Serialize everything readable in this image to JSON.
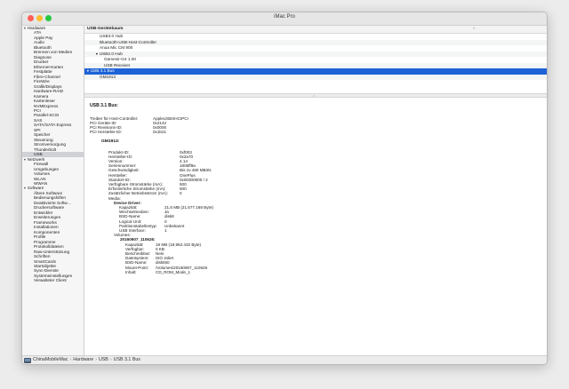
{
  "window": {
    "title": "iMac Pro"
  },
  "sidebar": {
    "sections": [
      {
        "label": "Hardware",
        "items": [
          "ATA",
          "Apple Pay",
          "Audio",
          "Bluetooth",
          "Brennen von Medien",
          "Diagnose",
          "Drucker",
          "Ethernet-Karten",
          "Festplatte",
          "Fibre-Channel",
          "FireWire",
          "Grafik/Displays",
          "Hardware-RAID",
          "Kamera",
          "Kartenleser",
          "NVMExpress",
          "PCI",
          "Parallel-SCSI",
          "SAS",
          "SATA/SATA Express",
          "SPI",
          "Speicher",
          "Steuerung",
          "Stromversorgung",
          "Thunderbolt",
          "USB"
        ]
      },
      {
        "label": "Netzwerk",
        "items": [
          "Firewall",
          "Umgebungen",
          "Volumes",
          "WLAN",
          "WWAN"
        ]
      },
      {
        "label": "Software",
        "items": [
          "Ältere Software",
          "Bedienungshilfen",
          "Deaktivierte Softw…",
          "Druckersoftware",
          "Entwickler",
          "Erweiterungen",
          "Frameworks",
          "Installationen",
          "Komponenten",
          "Profile",
          "Programme",
          "Protokolldateien",
          "Raw-Unterstützung",
          "Schriften",
          "SmartCards",
          "Startobjekte",
          "Sync-Dienste",
          "Systemeinstellungen",
          "Verwalteter Client"
        ]
      }
    ],
    "selected": "USB"
  },
  "tree": {
    "header": "USB-Gerätebaum",
    "sort_arrow": "^",
    "rows": [
      {
        "label": "USB3.0 Hub",
        "indent": 3
      },
      {
        "label": "Bluetooth-USB-Host-Controller",
        "indent": 3
      },
      {
        "label": "Anua Mic CM 900",
        "indent": 3
      },
      {
        "label": "USB2.0 Hub",
        "indent": 2,
        "expander": "▼"
      },
      {
        "label": "Gamesir-G4 1.00",
        "indent": 4
      },
      {
        "label": "USB Receiver",
        "indent": 4
      },
      {
        "label": "USB 3.1 Bus",
        "indent": 0,
        "expander": "▼",
        "selected": true
      },
      {
        "label": "GM1913",
        "indent": 3
      }
    ],
    "splitter_grip": "="
  },
  "detail": {
    "title": "USB 3.1 Bus:",
    "bus_info": [
      {
        "k": "Treiber für Host-Controller:",
        "v": "AppleUSBXHCIPCI"
      },
      {
        "k": "PCI Geräte-ID:",
        "v": "0x2142"
      },
      {
        "k": "PCI Revisions-ID:",
        "v": "0x0000"
      },
      {
        "k": "PCI Hersteller-ID:",
        "v": "0x1b21"
      }
    ],
    "device_title": "GM1913:",
    "device_info": [
      {
        "k": "Produkt-ID:",
        "v": "0xf003"
      },
      {
        "k": "Hersteller-ID:",
        "v": "0x2a70"
      },
      {
        "k": "Version:",
        "v": "4.14"
      },
      {
        "k": "Seriennummer:",
        "v": "1806ff9a"
      },
      {
        "k": "Geschwindigkeit:",
        "v": "Bis zu 480 MBit/s"
      },
      {
        "k": "Hersteller:",
        "v": "OnePlus"
      },
      {
        "k": "Standort-ID:",
        "v": "0x00300000 / 2"
      },
      {
        "k": "Verfügbare Stromstärke (mA):",
        "v": "500"
      },
      {
        "k": "Erforderliche Stromstärke (mA):",
        "v": "500"
      },
      {
        "k": "Zusätzlicher Betriebsstrom (mA):",
        "v": "0"
      }
    ],
    "media_label": "Media:",
    "driver_title": "Device Driver:",
    "driver_info": [
      {
        "k": "Kapazität:",
        "v": "21,6 MB (21.577.168 Byte)"
      },
      {
        "k": "Wechselmedien:",
        "v": "Ja"
      },
      {
        "k": "BSD-Name:",
        "v": "disk8"
      },
      {
        "k": "Logical Unit:",
        "v": "0"
      },
      {
        "k": "Partitionstabellentyp:",
        "v": "Unbekannt"
      },
      {
        "k": "USB Interface:",
        "v": "1"
      }
    ],
    "volumes_label": "Volumes:",
    "volume_title": "20160907_110626:",
    "volume_info": [
      {
        "k": "Kapazität:",
        "v": "19 MB (18.962.432 Byte)"
      },
      {
        "k": "Verfügbar:",
        "v": "0 KB"
      },
      {
        "k": "Beschreibbar:",
        "v": "Nein"
      },
      {
        "k": "Dateisystem:",
        "v": "ISO Joliet"
      },
      {
        "k": "BSD-Name:",
        "v": "disk8s0"
      },
      {
        "k": "Mount-Point:",
        "v": "/Volumes/20160907_110626"
      },
      {
        "k": "Inhalt:",
        "v": "CD_ROM_Mode_1"
      }
    ]
  },
  "statusbar": {
    "crumbs": [
      "ChinaMobileMac",
      "Hardware",
      "USB",
      "USB 3.1 Bus"
    ],
    "separator": "›"
  }
}
